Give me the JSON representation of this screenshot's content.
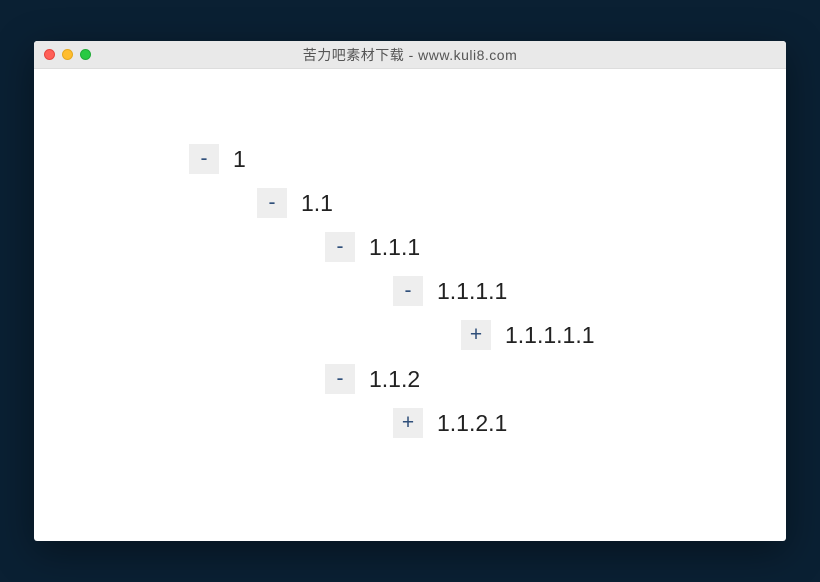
{
  "window": {
    "title": "苦力吧素材下载 - www.kuli8.com"
  },
  "icons": {
    "expanded": "-",
    "collapsed": "+"
  },
  "tree": {
    "n1": {
      "label": "1",
      "state": "expanded"
    },
    "n11": {
      "label": "1.1",
      "state": "expanded"
    },
    "n111": {
      "label": "1.1.1",
      "state": "expanded"
    },
    "n1111": {
      "label": "1.1.1.1",
      "state": "expanded"
    },
    "n11111": {
      "label": "1.1.1.1.1",
      "state": "collapsed"
    },
    "n112": {
      "label": "1.1.2",
      "state": "expanded"
    },
    "n1121": {
      "label": "1.1.2.1",
      "state": "collapsed"
    }
  }
}
